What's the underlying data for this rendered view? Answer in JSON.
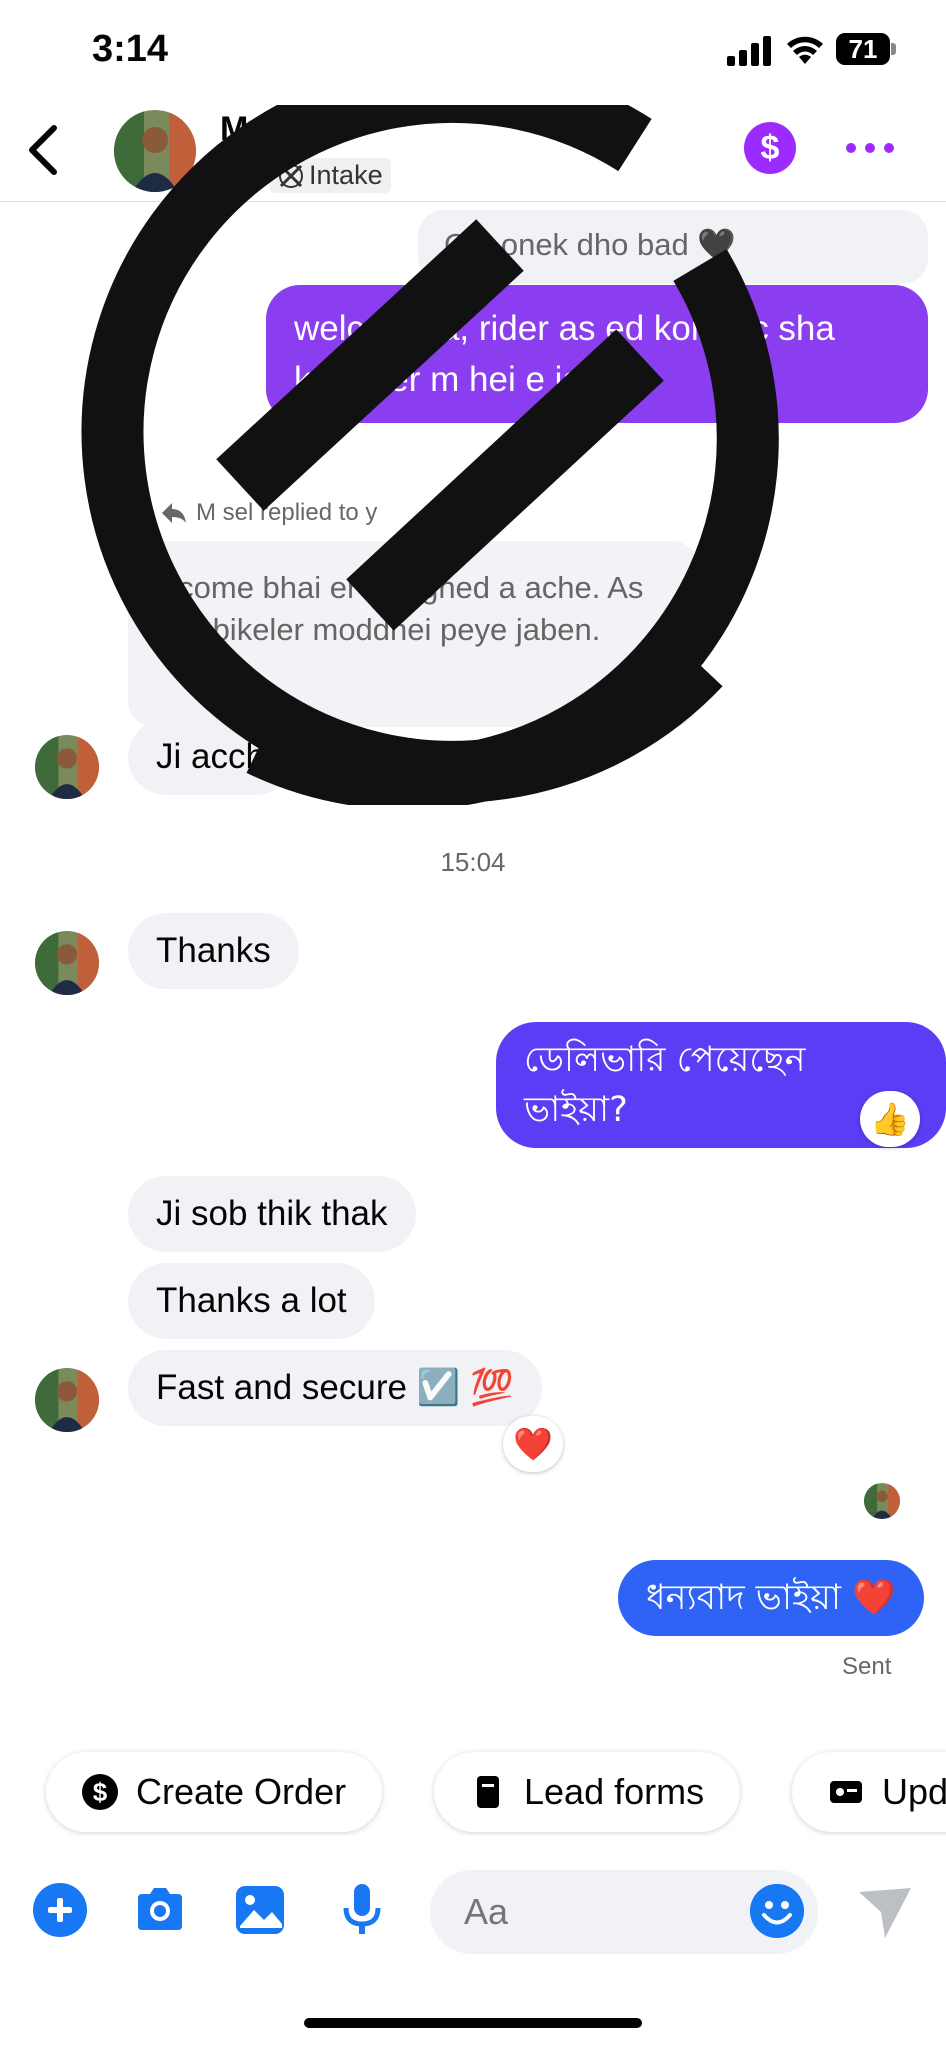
{
  "status_bar": {
    "time": "3:14",
    "battery": "71"
  },
  "header": {
    "contact_name": "M",
    "subtitle_fragment": "red",
    "label_chip": "Intake",
    "payment_symbol": "$"
  },
  "messages": {
    "quoted_top": "O  k onek dho    bad 🖤",
    "outgoing_welcome": "welc      bhaia, rider as      ed kora ac       sha kori b       er m      hei       e jaben.",
    "reply_label": "M      sel replied to y",
    "quoted_reply": "elcome bhai     er assigned    a ache. As    kori bikeler moddhei peye jaben.",
    "incoming_ji": "Ji acch",
    "timestamp": "15:04",
    "incoming_thanks": "Thanks",
    "outgoing_delivery": "ডেলিভারি পেয়েছেন ভাইয়া?",
    "reaction_delivery": "👍",
    "incoming_ok": "Ji sob thik thak",
    "incoming_thanks_lot": "Thanks a lot",
    "incoming_fast": "Fast and secure ☑️ 💯",
    "reaction_fast": "❤️",
    "outgoing_thanks": "ধন্যবাদ ভাইয়া ❤️",
    "sent_label": "Sent"
  },
  "quick_replies": {
    "create_order": "Create Order",
    "lead_forms": "Lead forms",
    "update": "Upd"
  },
  "composer": {
    "placeholder": "Aa"
  },
  "colors": {
    "accent_purple": "#9b2bff",
    "out_bubble_violet": "#8b3df0",
    "out_bubble_indigo": "#5b3df5",
    "out_bubble_blue": "#2f63f5",
    "icon_blue": "#1877f2"
  }
}
